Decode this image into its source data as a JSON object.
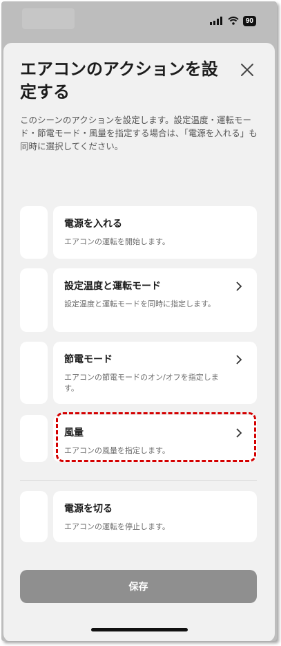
{
  "status": {
    "battery": "90"
  },
  "sheet": {
    "title": "エアコンのアクションを設定する",
    "description": "このシーンのアクションを設定します。設定温度・運転モード・節電モード・風量を指定する場合は、「電源を入れる」も同時に選択してください。"
  },
  "actions": [
    {
      "title": "電源を入れる",
      "subtitle": "エアコンの運転を開始します。"
    },
    {
      "title": "設定温度と運転モード",
      "subtitle": "設定温度と運転モードを同時に指定します。"
    },
    {
      "title": "節電モード",
      "subtitle": "エアコンの節電モードのオン/オフを指定します。"
    },
    {
      "title": "風量",
      "subtitle": "エアコンの風量を指定します。"
    },
    {
      "title": "電源を切る",
      "subtitle": "エアコンの運転を停止します。"
    }
  ],
  "footer": {
    "save_label": "保存"
  }
}
